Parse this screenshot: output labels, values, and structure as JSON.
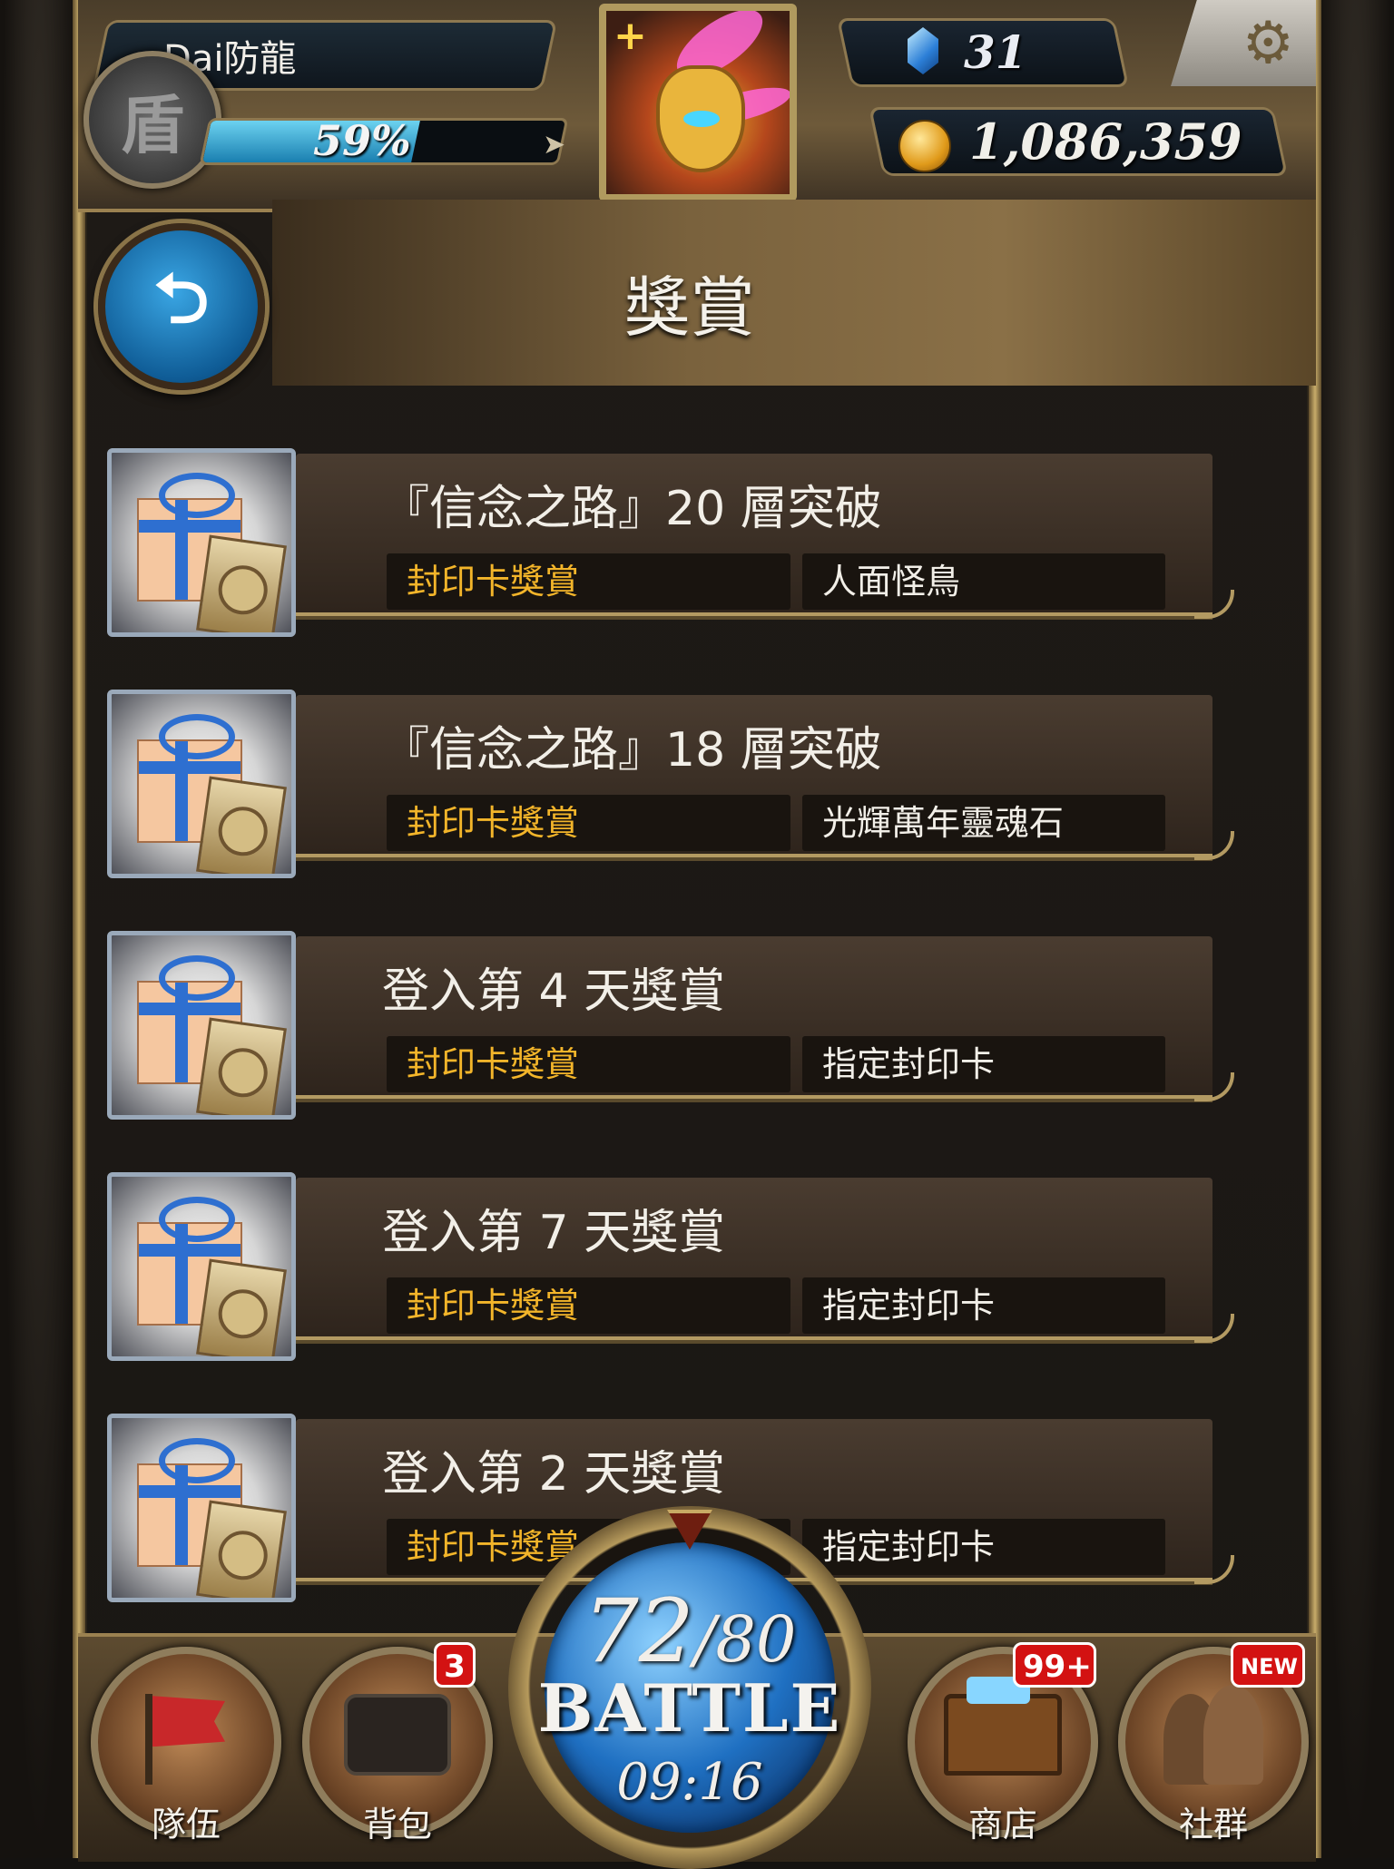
{
  "player": {
    "name": "Dai防龍",
    "rank_glyph": "盾",
    "exp_percent_label": "59%",
    "exp_fraction": 0.59
  },
  "currency": {
    "gems": "31",
    "coins": "1,086,359"
  },
  "header": {
    "title": "獎賞",
    "back_glyph": "⮌",
    "settings_glyph": "⚙"
  },
  "rewards": [
    {
      "title": "『信念之路』20 層突破",
      "type": "封印卡獎賞",
      "item": "人面怪鳥"
    },
    {
      "title": "『信念之路』18 層突破",
      "type": "封印卡獎賞",
      "item": "光輝萬年靈魂石"
    },
    {
      "title": "登入第 4 天獎賞",
      "type": "封印卡獎賞",
      "item": "指定封印卡"
    },
    {
      "title": "登入第 7 天獎賞",
      "type": "封印卡獎賞",
      "item": "指定封印卡"
    },
    {
      "title": "登入第 2 天獎賞",
      "type": "封印卡獎賞",
      "item": "指定封印卡"
    }
  ],
  "nav": {
    "team": {
      "label": "隊伍"
    },
    "bag": {
      "label": "背包",
      "badge": "3"
    },
    "shop": {
      "label": "商店",
      "badge": "99+"
    },
    "social": {
      "label": "社群",
      "badge": "NEW"
    }
  },
  "battle": {
    "stamina_current": "72",
    "stamina_max": "/80",
    "label": "BATTLE",
    "timer": "09:16"
  },
  "colors": {
    "accent_gold": "#f3b52a",
    "badge_red": "#d31212",
    "battle_blue": "#1f70c2"
  }
}
